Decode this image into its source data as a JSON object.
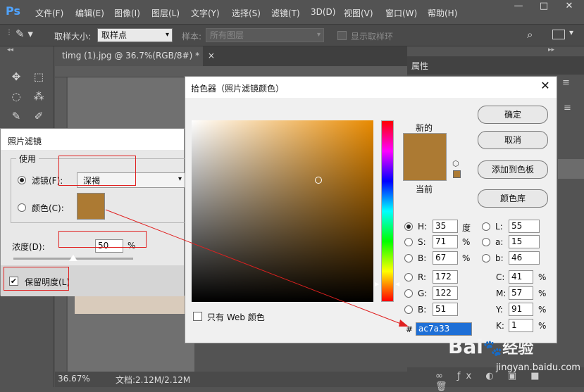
{
  "app": {
    "logo": "Ps"
  },
  "menu": [
    "文件(F)",
    "编辑(E)",
    "图像(I)",
    "图层(L)",
    "文字(Y)",
    "选择(S)",
    "滤镜(T)",
    "3D(D)",
    "视图(V)",
    "窗口(W)",
    "帮助(H)"
  ],
  "window_controls": {
    "minimize": "—",
    "maximize": "□",
    "close": "✕"
  },
  "options_bar": {
    "sample_size_label": "取样大小:",
    "sample_size_value": "取样点",
    "sample_label": "样本:",
    "sample_value": "所有图层",
    "show_ring_label": "显示取样环"
  },
  "document": {
    "tab_title": "timg (1).jpg @ 36.7%(RGB/8#) *",
    "close": "×",
    "zoom": "36.67%",
    "doc_info": "文档:2.12M/2.12M"
  },
  "right_panel": {
    "title": "属性"
  },
  "photo_filter": {
    "title": "照片滤镜",
    "use_group": "使用",
    "filter_label": "滤镜(F):",
    "filter_value": "深褐",
    "color_label": "颜色(C):",
    "density_label": "浓度(D):",
    "density_value": "50",
    "density_unit": "%",
    "density_level": 0.5,
    "preserve_label": "保留明度(L)",
    "preserve_checked": true
  },
  "color_picker": {
    "title": "拾色器（照片滤镜颜色）",
    "new_label": "新的",
    "current_label": "当前",
    "buttons": {
      "ok": "确定",
      "cancel": "取消",
      "add_swatch": "添加到色板",
      "libraries": "颜色库"
    },
    "web_only_label": "只有 Web 颜色",
    "hsb": [
      {
        "label": "H:",
        "value": "35",
        "unit": "度"
      },
      {
        "label": "S:",
        "value": "71",
        "unit": "%"
      },
      {
        "label": "B:",
        "value": "67",
        "unit": "%"
      }
    ],
    "rgb": [
      {
        "label": "R:",
        "value": "172"
      },
      {
        "label": "G:",
        "value": "122"
      },
      {
        "label": "B:",
        "value": "51"
      }
    ],
    "lab": [
      {
        "label": "L:",
        "value": "55"
      },
      {
        "label": "a:",
        "value": "15"
      },
      {
        "label": "b:",
        "value": "46"
      }
    ],
    "cmyk": [
      {
        "label": "C:",
        "value": "41",
        "unit": "%"
      },
      {
        "label": "M:",
        "value": "57",
        "unit": "%"
      },
      {
        "label": "Y:",
        "value": "91",
        "unit": "%"
      },
      {
        "label": "K:",
        "value": "1",
        "unit": "%"
      }
    ],
    "hex_label": "#",
    "hex_value": "ac7a33"
  },
  "watermark": {
    "brand": "Bai",
    "brand2": "经验",
    "url": "jingyan.baidu.com"
  },
  "colors": {
    "selected": "#ac7a33",
    "ps_blue": "#4fa3ff",
    "annotation_red": "#e02020"
  }
}
